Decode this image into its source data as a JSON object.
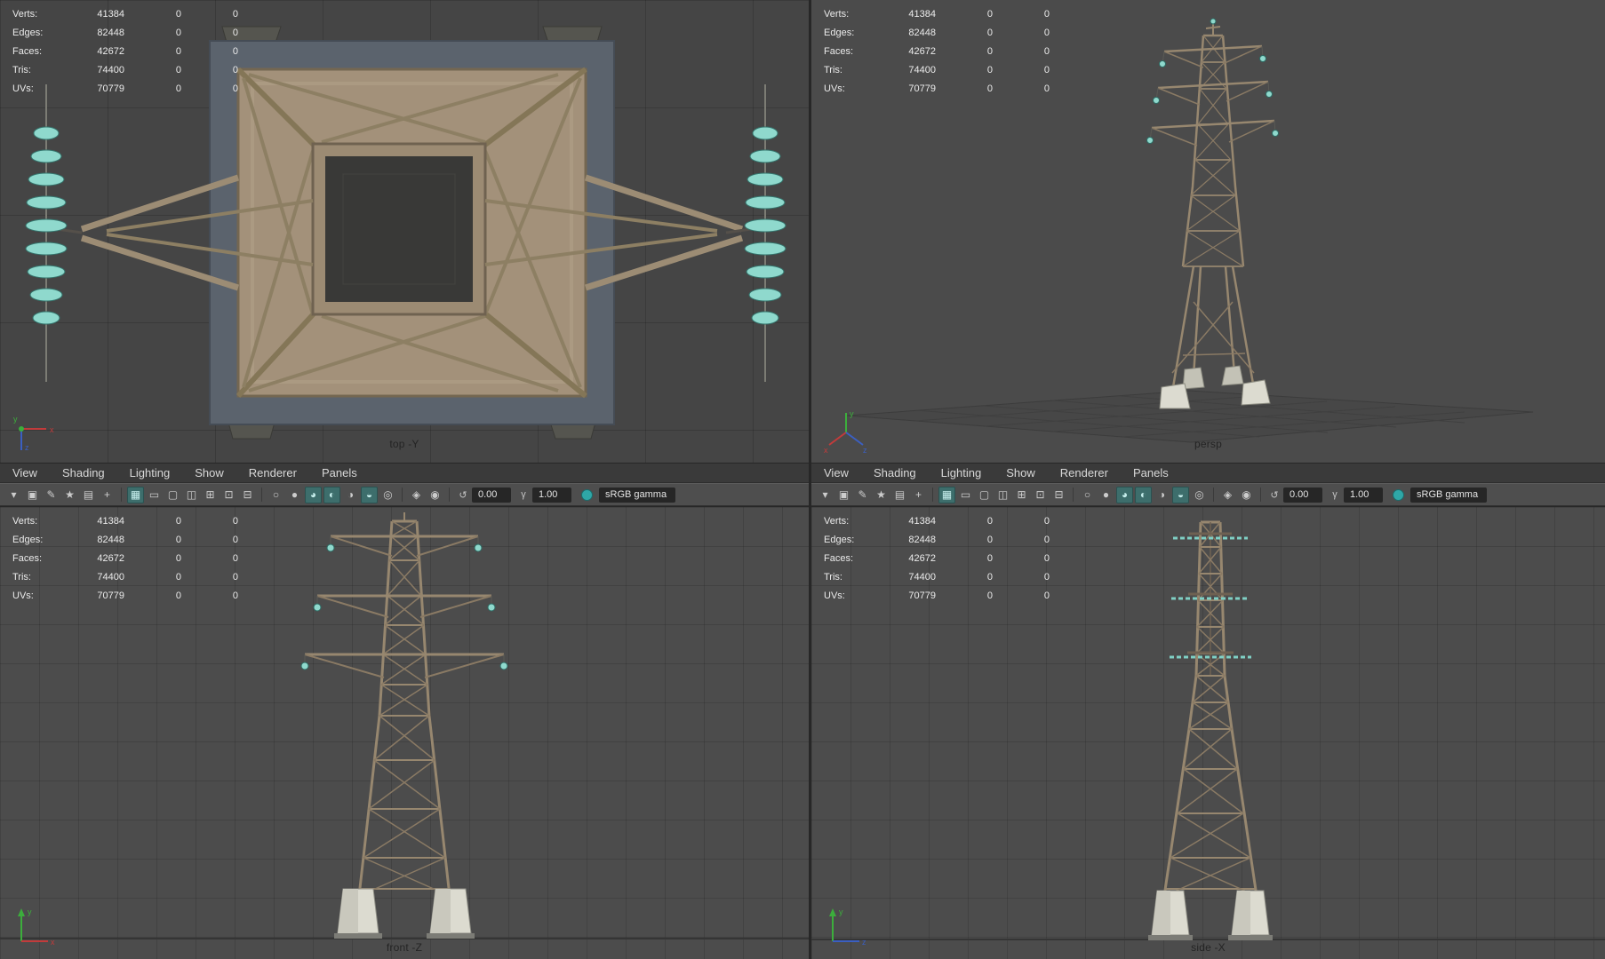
{
  "colors": {
    "viewport_bg": "#4b4b4b",
    "grid_line": "#3d3d3d",
    "menu_bg": "#3a3a3a",
    "toolbar_bg": "#4e4e4e",
    "hud_text": "#ebebeb",
    "viewport_label_text": "#242424",
    "accent_teal": "#2fa7a7",
    "axis_x": "#c23b3b",
    "axis_y": "#3cae3c",
    "axis_z": "#3b5fc2",
    "tower_steel": "#97876f",
    "insulator_teal": "#8fd9cd",
    "concrete_foot": "#dcdbd0"
  },
  "hud": {
    "rows": [
      {
        "label": "Verts:",
        "value": "41384",
        "a": "0",
        "b": "0"
      },
      {
        "label": "Edges:",
        "value": "82448",
        "a": "0",
        "b": "0"
      },
      {
        "label": "Faces:",
        "value": "42672",
        "a": "0",
        "b": "0"
      },
      {
        "label": "Tris:",
        "value": "74400",
        "a": "0",
        "b": "0"
      },
      {
        "label": "UVs:",
        "value": "70779",
        "a": "0",
        "b": "0"
      }
    ]
  },
  "menus": [
    {
      "name": "menu-view",
      "label": "View",
      "it": "true"
    },
    {
      "name": "menu-shading",
      "label": "Shading",
      "it": "true"
    },
    {
      "name": "menu-lighting",
      "label": "Lighting",
      "it": "true"
    },
    {
      "name": "menu-show",
      "label": "Show",
      "it": "true"
    },
    {
      "name": "menu-renderer",
      "label": "Renderer",
      "it": "true"
    },
    {
      "name": "menu-panels",
      "label": "Panels",
      "it": "true"
    }
  ],
  "toolbar": {
    "buttons": [
      {
        "name": "panel-menu-icon",
        "glyph": "▾",
        "it": "true"
      },
      {
        "name": "select-camera-icon",
        "glyph": "▣",
        "it": "true"
      },
      {
        "name": "camera-attributes-icon",
        "glyph": "✎",
        "it": "true"
      },
      {
        "name": "bookmark-icon",
        "glyph": "★",
        "it": "true"
      },
      {
        "name": "image-plane-icon",
        "glyph": "▤",
        "it": "true"
      },
      {
        "name": "pan-zoom-icon",
        "glyph": "+",
        "it": "true"
      },
      {
        "name": "separator",
        "glyph": "",
        "it": "false"
      },
      {
        "name": "grid-toggle-icon",
        "glyph": "▦",
        "active": true,
        "it": "true"
      },
      {
        "name": "film-gate-icon",
        "glyph": "▭",
        "it": "true"
      },
      {
        "name": "resolution-gate-icon",
        "glyph": "▢",
        "it": "true"
      },
      {
        "name": "gate-mask-icon",
        "glyph": "◫",
        "it": "true"
      },
      {
        "name": "field-chart-icon",
        "glyph": "⊞",
        "it": "true"
      },
      {
        "name": "safe-action-icon",
        "glyph": "⊡",
        "it": "true"
      },
      {
        "name": "safe-title-icon",
        "glyph": "⊟",
        "it": "true"
      },
      {
        "name": "separator",
        "glyph": "",
        "it": "false"
      },
      {
        "name": "wireframe-icon",
        "glyph": "○",
        "it": "true"
      },
      {
        "name": "shaded-icon",
        "glyph": "●",
        "it": "true"
      },
      {
        "name": "textured-icon",
        "glyph": "◕",
        "active": true,
        "it": "true"
      },
      {
        "name": "use-all-lights-icon",
        "glyph": "◐",
        "active": true,
        "it": "true"
      },
      {
        "name": "shadows-icon",
        "glyph": "◑",
        "it": "true"
      },
      {
        "name": "ambient-occlusion-icon",
        "glyph": "◒",
        "active": true,
        "it": "true"
      },
      {
        "name": "anti-alias-icon",
        "glyph": "◎",
        "it": "true"
      },
      {
        "name": "separator",
        "glyph": "",
        "it": "false"
      },
      {
        "name": "xray-icon",
        "glyph": "◈",
        "it": "true"
      },
      {
        "name": "isolate-select-icon",
        "glyph": "◉",
        "it": "true"
      },
      {
        "name": "separator",
        "glyph": "",
        "it": "false"
      }
    ],
    "exposure_icon": "↺",
    "exposure_value": "0.00",
    "gamma_icon": "γ",
    "gamma_value": "1.00",
    "view_transform": "sRGB gamma"
  },
  "viewports": {
    "top": {
      "label": "top -Y"
    },
    "persp": {
      "label": "persp"
    },
    "front": {
      "label": "front -Z"
    },
    "side": {
      "label": "side -X"
    }
  },
  "gizmo": {
    "x": "x",
    "y": "y",
    "z": "z"
  }
}
